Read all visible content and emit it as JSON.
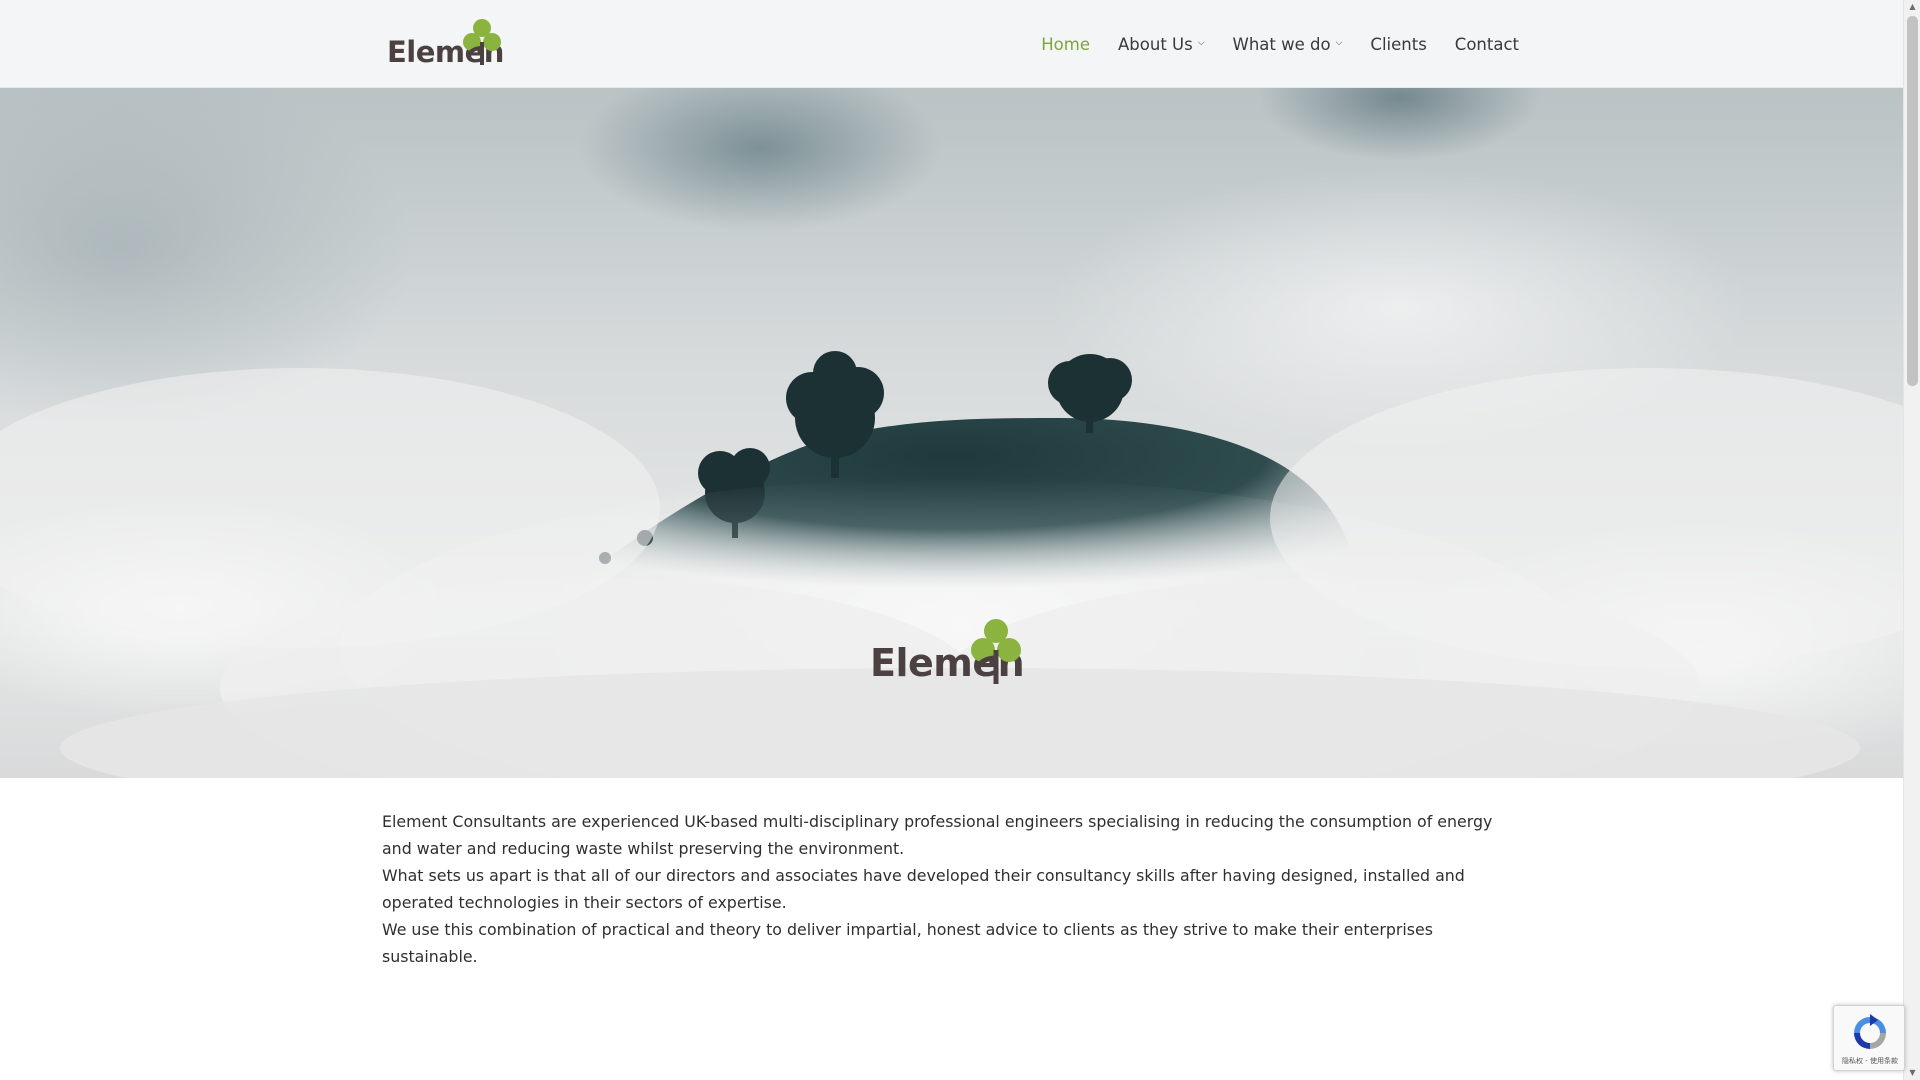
{
  "header": {
    "logo_text": "Elemen",
    "nav": [
      {
        "label": "Home",
        "active": true,
        "has_dropdown": false
      },
      {
        "label": "About Us",
        "active": false,
        "has_dropdown": true
      },
      {
        "label": "What we do",
        "active": false,
        "has_dropdown": true
      },
      {
        "label": "Clients",
        "active": false,
        "has_dropdown": false
      },
      {
        "label": "Contact",
        "active": false,
        "has_dropdown": false
      }
    ]
  },
  "hero": {
    "logo_text": "Elemen"
  },
  "content": {
    "paragraphs": [
      "Element Consultants are experienced UK-based multi-disciplinary professional engineers specialising in reducing the consumption of energy and water and reducing waste whilst preserving the environment.",
      "What sets us apart is that all of our directors and associates have developed their consultancy skills after having designed, installed and operated technologies in their sectors of expertise.",
      "We use this combination of practical and theory to deliver impartial, honest advice to clients as they strive to make their enterprises sustainable."
    ]
  },
  "recaptcha": {
    "footer_text": "隐私权 - 使用条款"
  },
  "colors": {
    "accent": "#7ea53c",
    "logo_leaf": "#8ab43f",
    "logo_text": "#4b4140",
    "header_bg": "#f4f5f6",
    "body_text": "#2f2f2f"
  },
  "icons": {
    "logo": "clover-leaf-icon",
    "dropdown": "chevron-down-icon",
    "recaptcha": "recaptcha-icon"
  }
}
